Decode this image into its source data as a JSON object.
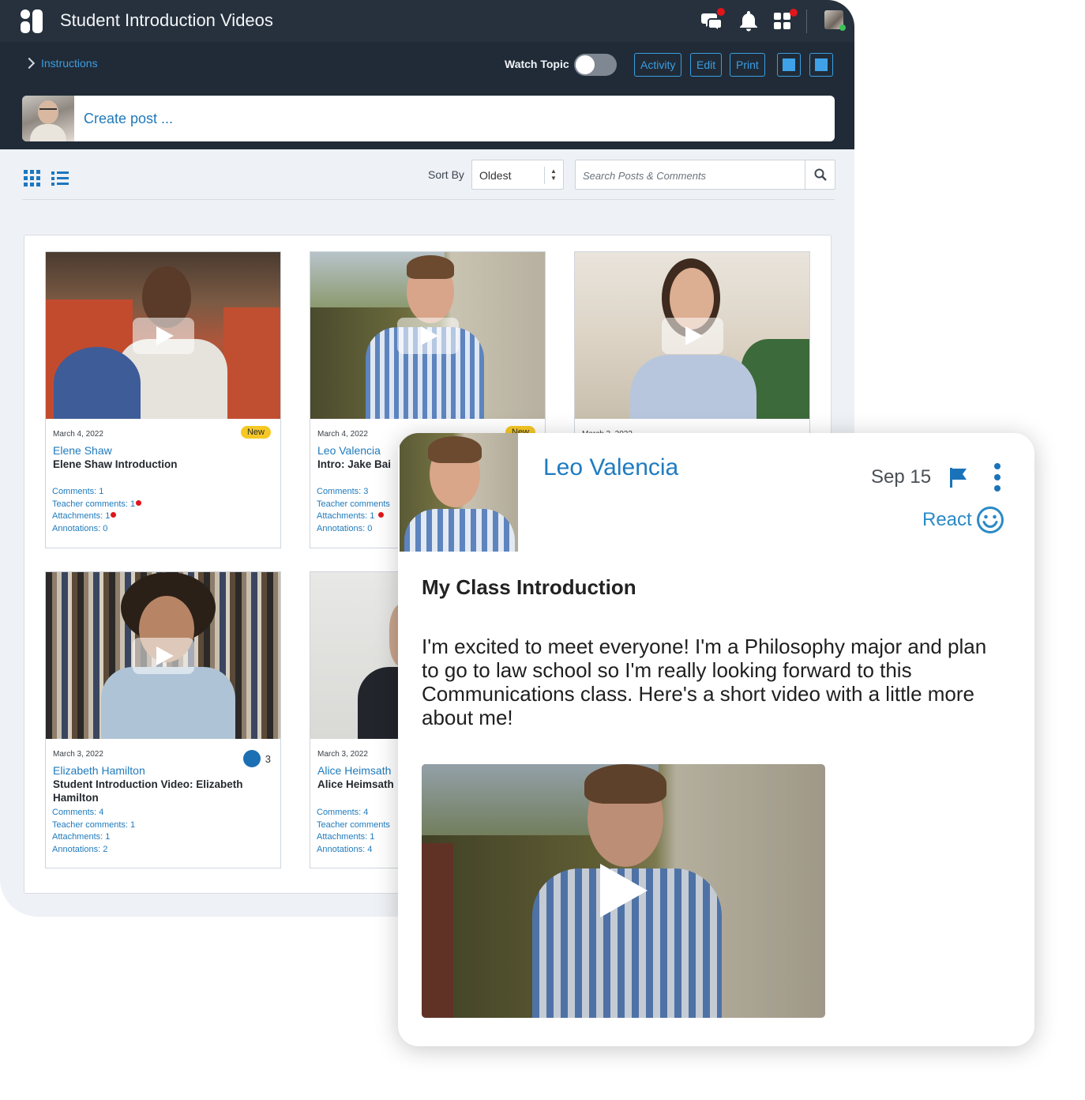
{
  "app": {
    "title": "Student Introduction Videos",
    "icons": [
      "logo-icon",
      "chat-icon",
      "bell-icon",
      "apps-icon",
      "user-avatar"
    ]
  },
  "toolbar": {
    "instructions_label": "Instructions",
    "watch_topic_label": "Watch Topic",
    "watch_topic_on": false,
    "activity_label": "Activity",
    "edit_label": "Edit",
    "print_label": "Print"
  },
  "create_post": {
    "placeholder": "Create post ..."
  },
  "filters": {
    "sort_label": "Sort By",
    "sort_value": "Oldest",
    "search_placeholder": "Search Posts & Comments"
  },
  "cards": [
    {
      "date": "March 4, 2022",
      "badge": "New",
      "author": "Elene Shaw",
      "title": "Elene Shaw Introduction",
      "comments": "Comments: 1",
      "teacher_comments": "Teacher comments: 1",
      "attachments": "Attachments: 1",
      "annotations": "Annotations: 0"
    },
    {
      "date": "March 4, 2022",
      "badge": "New",
      "author": "Leo Valencia",
      "title": "Intro: Jake Bai",
      "comments": "Comments: 3",
      "teacher_comments": "Teacher comments",
      "attachments": "Attachments: 1",
      "annotations": "Annotations: 0"
    },
    {
      "date": "March 3, 2022",
      "author": "",
      "title": ""
    },
    {
      "date": "March 3, 2022",
      "reactions": "3",
      "author": "Elizabeth Hamilton",
      "title": "Student Introduction Video: Elizabeth Hamilton",
      "comments": "Comments: 4",
      "teacher_comments": "Teacher comments: 1",
      "attachments": "Attachments: 1",
      "annotations": "Annotations: 2"
    },
    {
      "date": "March 3, 2022",
      "author": "Alice Heimsath",
      "title": "Alice Heimsath",
      "comments": "Comments: 4",
      "teacher_comments": "Teacher comments",
      "attachments": "Attachments: 1",
      "annotations": "Annotations: 4"
    }
  ],
  "post": {
    "author": "Leo Valencia",
    "date": "Sep 15",
    "react_label": "React",
    "title": "My Class Introduction",
    "body": "I'm excited to meet everyone! I'm a Philosophy major and plan to go to law school so I'm really looking forward to this Communications class.  Here's a short video with a little more about me!"
  },
  "colors": {
    "topbar": "#26313d",
    "accent_blue": "#1f7bbd",
    "notification_red": "#e0161b",
    "new_badge": "#f6c825"
  }
}
